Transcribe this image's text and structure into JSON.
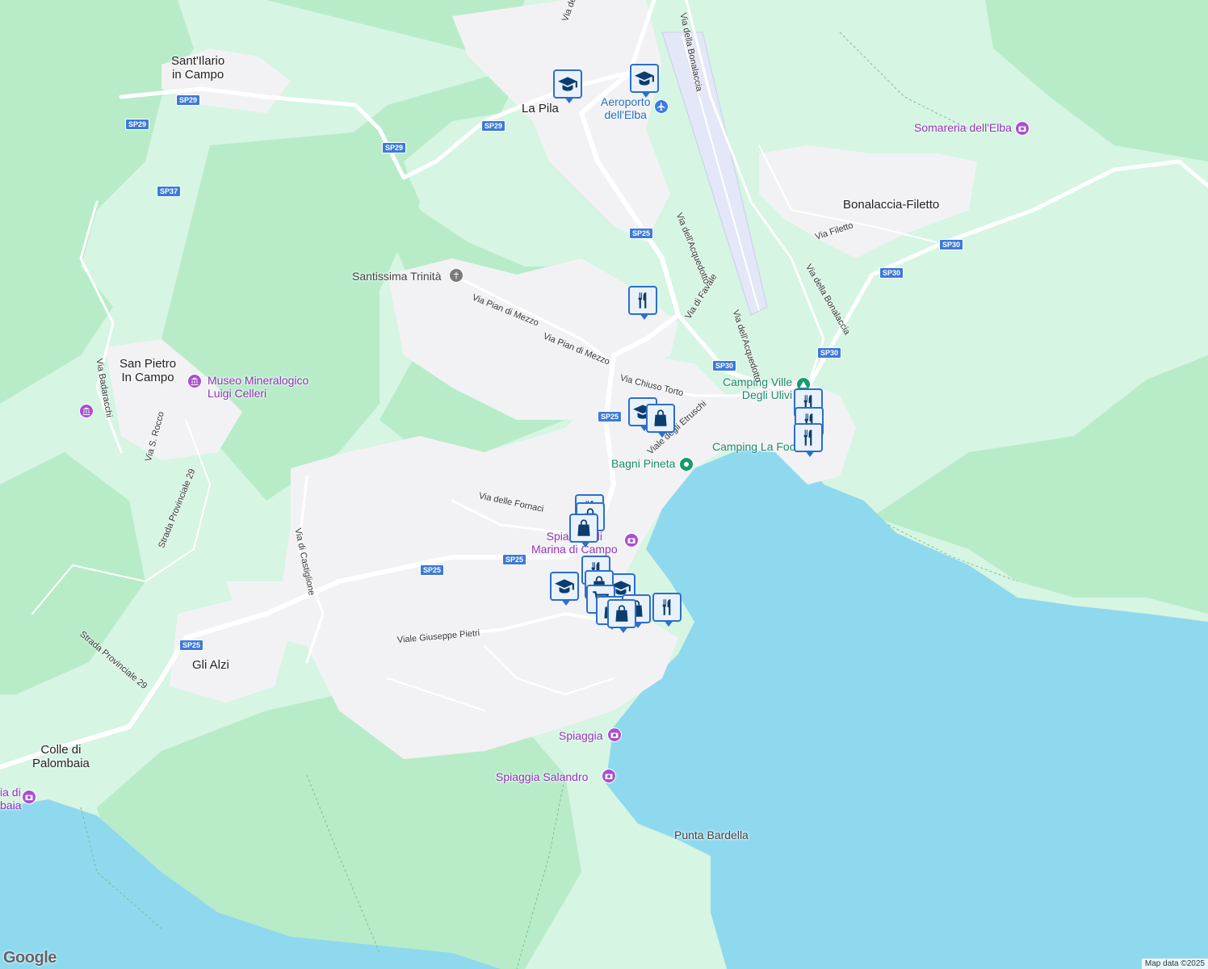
{
  "map": {
    "colors": {
      "land": "#d6f5e3",
      "forest": "#b8ecc9",
      "sea": "#8fd9ee",
      "urban": "#f2f2f4",
      "road": "#ffffff",
      "airport": "#e3e7f7",
      "pin": "#2c6fc9"
    },
    "places": {
      "santilario": "Sant'Ilario\nin Campo",
      "lapila": "La Pila",
      "sanpietro": "San Pietro\nIn Campo",
      "bonalaccia": "Bonalaccia-Filetto",
      "glialzi": "Gli Alzi",
      "colle": "Colle di\nPalombaia",
      "marina": "Marina di Campo"
    },
    "pois": {
      "aeroporto": "Aeroporto\ndell'Elba",
      "somareria": "Somareria dell'Elba",
      "santissima": "Santissima Trinità",
      "museo": "Museo Mineralogico\nLuigi Celleri",
      "campingville": "Camping Ville\nDegli Ulivi",
      "campinglafoce": "Camping La Foce",
      "bagnipineta": "Bagni Pineta",
      "spiaggiamarina": "Spiaggia di\nMarina di Campo",
      "spiaggia": "Spiaggia",
      "salandro": "Spiaggia Salandro",
      "puntabardella": "Punta Bardella",
      "spiaggiadi": "ia di\nbaia"
    },
    "streets": {
      "bonalaccia_top": "Via della Bonalaccia",
      "viadel": "Via del",
      "acquedotto1": "Via dell'Acquedotto",
      "acquedotto2": "Via dell'Acquedotto",
      "favale": "Via di Favale",
      "filetto": "Via Filetto",
      "bonalaccia2": "Via della Bonalaccia",
      "pianmezzo1": "Via Pian di Mezzo",
      "pianmezzo2": "Via Pian di Mezzo",
      "chiuso": "Via Chiuso Torto",
      "etruschi": "Viale degli Etruschi",
      "fornaci": "Via delle Fornaci",
      "castiglione": "Via di Castiglione",
      "pietri": "Viale Giuseppe Pietri",
      "sp29road": "Strada Provinciale 29",
      "sp29road2": "Strada Provinciale 29",
      "badaracchi": "Via Badaracchi",
      "srocco": "Via S. Rocco"
    },
    "shields": [
      "SP29",
      "SP29",
      "SP29",
      "SP37",
      "SP25",
      "SP25",
      "SP25",
      "SP25",
      "SP25",
      "SP30",
      "SP30",
      "SP30",
      "SP30"
    ],
    "attribution": "Map data ©2025",
    "logo": "Google"
  }
}
